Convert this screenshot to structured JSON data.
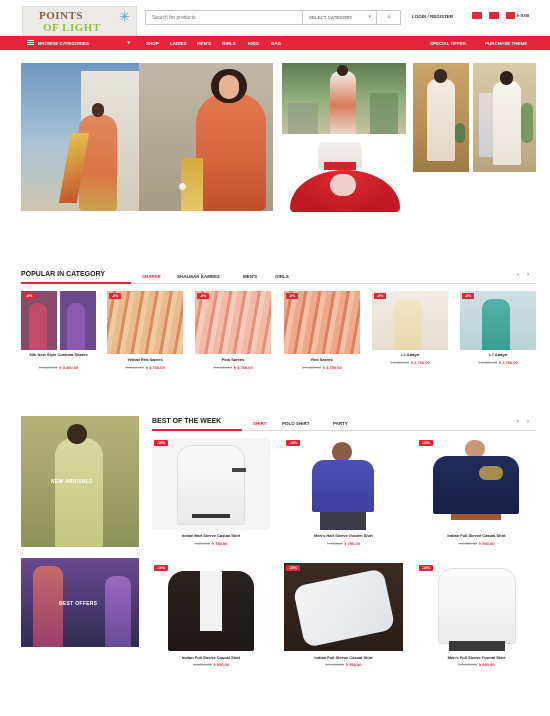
{
  "header": {
    "logo_line1": "POINTS",
    "logo_line2": "OF LIGHT",
    "search_placeholder": "Search for products",
    "category_select": "SELECT CATEGORY",
    "login_register": "LOGIN / REGISTER",
    "cart_total": "৳ 0.00"
  },
  "nav": {
    "browse": "BROWSE CATEGORIES",
    "items": [
      "SHOP",
      "LADIES",
      "MEN'S",
      "GIRLS",
      "KIDS",
      "BAG"
    ],
    "special_offer": "SPECIAL OFFER",
    "purchase_theme": "PURCHASE THEME"
  },
  "popular": {
    "title": "POPULAR IN CATEGORY",
    "tabs": [
      "SHAREE",
      "SHALWAR KAMEEZ",
      "MEN'S",
      "GIRLS"
    ],
    "products": [
      {
        "badge": "-6%",
        "name": "Silk New Style Cushma Sharee",
        "old": "৳ 3,600.00",
        "new": "৳ 3,400.00"
      },
      {
        "badge": "-6%",
        "name": "Yellow Red Sarees",
        "old": "৳ 4,000.00",
        "new": "৳ 3,750.00"
      },
      {
        "badge": "-6%",
        "name": "Pink Sarees",
        "old": "৳ 4,000.00",
        "new": "৳ 3,750.00"
      },
      {
        "badge": "-6%",
        "name": "Red Sarees",
        "old": "৳ 4,000.00",
        "new": "৳ 3,750.00"
      },
      {
        "badge": "-6%",
        "name": "L1 Abaya",
        "old": "৳ 3,000.00",
        "new": "৳ 2,750.00"
      },
      {
        "badge": "-6%",
        "name": "L7 Abaya",
        "old": "৳ 3,000.00",
        "new": "৳ 2,750.00"
      }
    ]
  },
  "banners": {
    "new_arrivals": "NEW ARRIVALS",
    "best_offers": "BEST OFFERS"
  },
  "best_week": {
    "title": "BEST OF THE WEEK",
    "tabs": [
      "SHIRT",
      "POLO SHIRT",
      "PARTY"
    ],
    "products": [
      {
        "badge": "-10%",
        "name": "Indian Half Sleeve Casual Shirt",
        "old": "৳ 850.00",
        "new": "৳ 750.00"
      },
      {
        "badge": "-10%",
        "name": "Men's Half Sleeve Golden Shirt",
        "old": "৳ 850.00",
        "new": "৳ 750.00"
      },
      {
        "badge": "-10%",
        "name": "Indian Full Sleeve Casual Shirt",
        "old": "৳ 1,050.00",
        "new": "৳ 950.00"
      },
      {
        "badge": "-10%",
        "name": "Indian Full Sleeve Casual Shirt",
        "old": "৳ 1,050.00",
        "new": "৳ 950.00"
      },
      {
        "badge": "-10%",
        "name": "Indian Full Sleeve Casual Shirt",
        "old": "৳ 1,050.00",
        "new": "৳ 950.00"
      },
      {
        "badge": "-10%",
        "name": "Men's Full Sleeve Formal Shirt",
        "old": "৳ 1,050.00",
        "new": "৳ 950.00"
      }
    ]
  },
  "colors": {
    "accent": "#e3243b"
  }
}
